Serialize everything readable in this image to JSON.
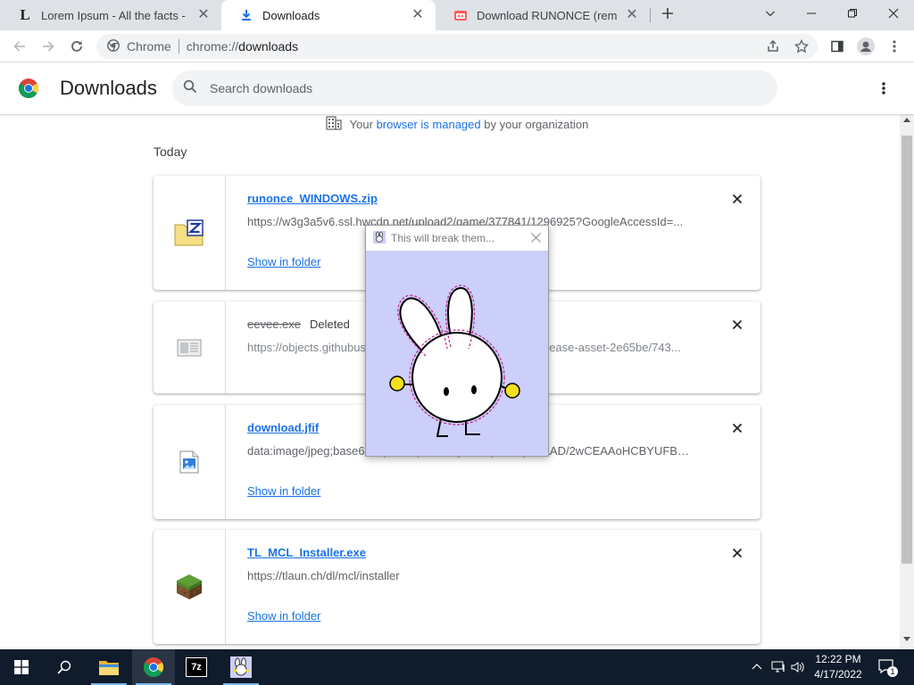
{
  "tabs": [
    {
      "title": "Lorem Ipsum - All the facts - Lipsum generator",
      "favicon": "lipsum-favicon",
      "close": "✕"
    },
    {
      "title": "Downloads",
      "favicon": "download-icon",
      "close": "✕"
    },
    {
      "title": "Download RUNONCE (remember me)",
      "favicon": "itchio-favicon",
      "close": "✕"
    }
  ],
  "toolbar": {
    "chip_label": "Chrome",
    "url_scheme": "chrome://",
    "url_host": "downloads"
  },
  "header": {
    "title": "Downloads",
    "search_placeholder": "Search downloads"
  },
  "managed": {
    "prefix": "Your",
    "link": "browser is managed",
    "suffix": "by your organization"
  },
  "section_label": "Today",
  "downloads": [
    {
      "file_name": "runonce_WINDOWS.zip",
      "url": "https://w3g3a5v6.ssl.hwcdn.net/upload2/game/377841/1296925?GoogleAccessId=...",
      "action": "Show in folder",
      "icon": "zip-archive-icon"
    },
    {
      "file_name": "eevee.exe",
      "status": "Deleted",
      "url": "https://objects.githubusercontent.com/github-production-release-asset-2e65be/743...",
      "icon": "generic-file-icon"
    },
    {
      "file_name": "download.jfif",
      "url": "data:image/jpeg;base64,/9j/4AAQSkZJRgABAQAAAQABAAD/2wCEAAoHCBYUFBcU...",
      "action": "Show in folder",
      "icon": "image-file-icon"
    },
    {
      "file_name": "TL_MCL_Installer.exe",
      "url": "https://tlaun.ch/dl/mcl/installer",
      "action": "Show in folder",
      "icon": "grass-block-icon"
    }
  ],
  "popup": {
    "title": "This will break them..."
  },
  "taskbar": {
    "time": "12:22 PM",
    "date": "4/17/2022",
    "notification_count": "1",
    "zip_label": "7z"
  },
  "colors": {
    "accent": "#1a73e8",
    "tab_strip": "#dee1e6",
    "popup_background": "#cccff9",
    "taskbar": "#101b2b"
  }
}
